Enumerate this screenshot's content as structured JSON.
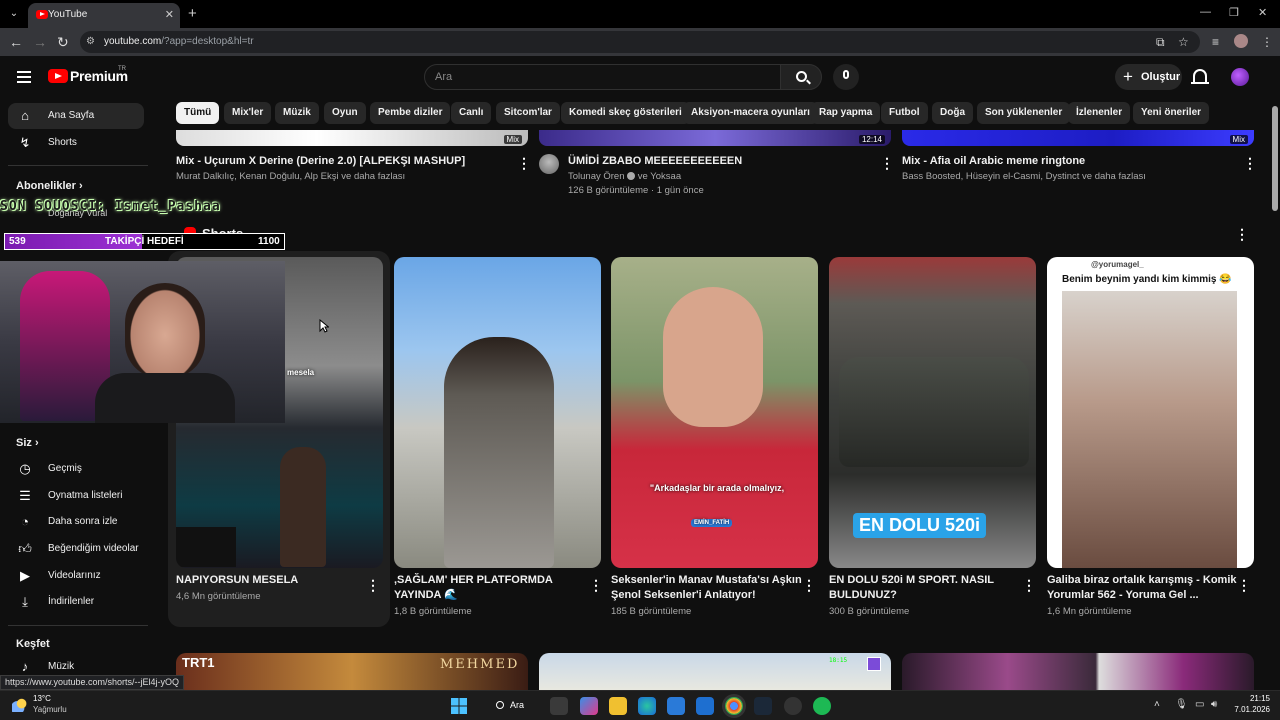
{
  "browser": {
    "tab_title": "YouTube",
    "url_host": "youtube.com",
    "url_rest": "/?app=desktop&hl=tr"
  },
  "header": {
    "logo_text": "Premium",
    "logo_country": "TR",
    "search_placeholder": "Ara",
    "create_label": "Oluştur"
  },
  "chips": [
    "Tümü",
    "Mix'ler",
    "Müzik",
    "Oyun",
    "Pembe diziler",
    "Canlı",
    "Sitcom'lar",
    "Komedi skeç gösterileri",
    "Aksiyon-macera oyunları",
    "Rap yapma",
    "Futbol",
    "Doğa",
    "Son yüklenenler",
    "İzlenenler",
    "Yeni öneriler"
  ],
  "sidebar": {
    "home": "Ana Sayfa",
    "shorts": "Shorts",
    "subscriptions": "Abonelikler",
    "you": "Siz",
    "history": "Geçmiş",
    "playlists": "Oynatma listeleri",
    "watch_later": "Daha sonra izle",
    "liked": "Beğendiğim videolar",
    "your_videos": "Videolarınız",
    "downloads": "İndirilenler",
    "explore": "Keşfet",
    "music": "Müzik",
    "sub_partial": "Doğanay Vural"
  },
  "top_row": [
    {
      "title": "Mix - Uçurum X Derine (Derine 2.0) [ALPEKŞI MASHUP]",
      "meta1": "Murat Dalkılıç, Kenan Doğulu, Alp Ekşi ve daha fazlası",
      "meta2": "",
      "badge": "Mix"
    },
    {
      "title": "ÜMİDİ ZBABO MEEEEEEEEEEEN",
      "meta1": "Tolunay Ören",
      "meta1b": "ve Yoksaa",
      "meta2": "126 B görüntüleme · 1 gün önce",
      "badge": "12:14"
    },
    {
      "title": "Mix - Afia oil Arabic meme ringtone",
      "meta1": "Bass Boosted, Hüseyin el-Casmi, Dystinct ve daha fazlası",
      "meta2": "",
      "badge": "Mix"
    }
  ],
  "shorts_label": "Shorts",
  "shorts": [
    {
      "title": "NAPIYORSUN MESELA",
      "views": "4,6 Mn görüntüleme",
      "caption": "mesela"
    },
    {
      "title": ",SAĞLAM' HER PLATFORMDA YAYINDA 🌊",
      "views": "1,8 B görüntüleme",
      "caption": ""
    },
    {
      "title": "Seksenler'in Manav Mustafa'sı Aşkın Şenol Seksenler'i Anlatıyor!",
      "views": "185 B görüntüleme",
      "caption": "\"Arkadaşlar bir arada olmalıyız,",
      "caption2": "EMİN_FATİH"
    },
    {
      "title": "EN DOLU 520i M SPORT. NASIL BULDUNUZ?",
      "views": "300 B görüntüleme",
      "caption": "EN DOLU 520i"
    },
    {
      "title": "Galiba biraz ortalık karışmış - Komik Yorumlar 562 - Yoruma Gel ...",
      "views": "1,6 Mn görüntüleme",
      "caption": "Benim beynim yandı kim kimmiş 😂",
      "handle": "@yorumagel_"
    }
  ],
  "bottom_row": [
    {
      "label1": "TRT1",
      "label2": "MEHMED"
    },
    {
      "label1": "18:15"
    },
    {
      "label1": ""
    }
  ],
  "overlay": {
    "stream_name": "SON SOUOSCI: Ismet_Pashaa",
    "goal_current": "539",
    "goal_label": "TAKİPÇİ HEDEFİ",
    "goal_target": "1100",
    "goal_fraction": 0.49
  },
  "status_url": "https://www.youtube.com/shorts/--jEl4j-yOQ",
  "taskbar": {
    "temp": "13°C",
    "weather": "Yağmurlu",
    "search": "Ara",
    "time": "21:15",
    "date": "7.01.2026"
  }
}
